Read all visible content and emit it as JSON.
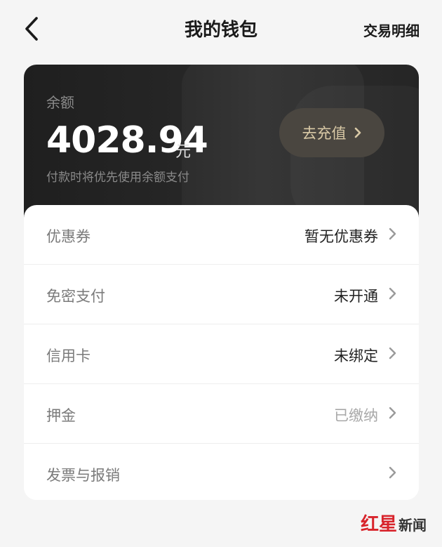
{
  "nav": {
    "title": "我的钱包",
    "right_link": "交易明细",
    "back_icon": "chevron-left-icon"
  },
  "balance": {
    "label": "余额",
    "amount": "4028.94",
    "unit": "元",
    "note": "付款时将优先使用余额支付",
    "topup_label": "去充值",
    "topup_icon": "chevron-right-icon"
  },
  "colors": {
    "dark_panel": "#262626",
    "topup_bg": "#4a4640",
    "topup_text": "#d9c9a6",
    "watermark_red": "#d8242c"
  },
  "menu": {
    "items": [
      {
        "label": "优惠券",
        "value": "暂无优惠券"
      },
      {
        "label": "免密支付",
        "value": "未开通"
      },
      {
        "label": "信用卡",
        "value": "未绑定"
      },
      {
        "label": "押金",
        "value": "已缴纳"
      },
      {
        "label": "发票与报销",
        "value": ""
      }
    ]
  },
  "watermark": {
    "brand": "红星",
    "tail": "新闻"
  }
}
